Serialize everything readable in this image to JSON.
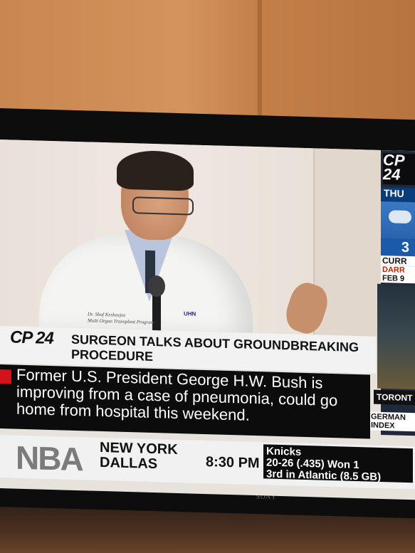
{
  "tv": {
    "brand": "SONY"
  },
  "video": {
    "coat_name": "Dr. Shaf Keshavjee",
    "coat_program": "Multi Organ Transplant Program",
    "coat_logo": "UHN"
  },
  "sidebar": {
    "logo": "CP 24",
    "day": "THU",
    "temperature": "3",
    "current_label": "CURR",
    "warning_label": "DARR",
    "warning_date": "FEB 9",
    "market_label": "TORONT",
    "index_label": "GERMAN INDEX"
  },
  "headline": {
    "logo": "CP 24",
    "text": "SURGEON TALKS ABOUT GROUNDBREAKING PROCEDURE"
  },
  "story": {
    "text": "Former U.S. President George H.W. Bush is improving from a case of pneumonia, could go home from hospital this weekend."
  },
  "ticker": {
    "league": "NBA",
    "team_home": "NEW YORK",
    "team_away": "DALLAS",
    "time": "8:30 PM",
    "stats_team": "Knicks",
    "stats_line1": "20-26  (.435)   Won 1",
    "stats_line2": "3rd in Atlantic  (8.5 GB)"
  }
}
